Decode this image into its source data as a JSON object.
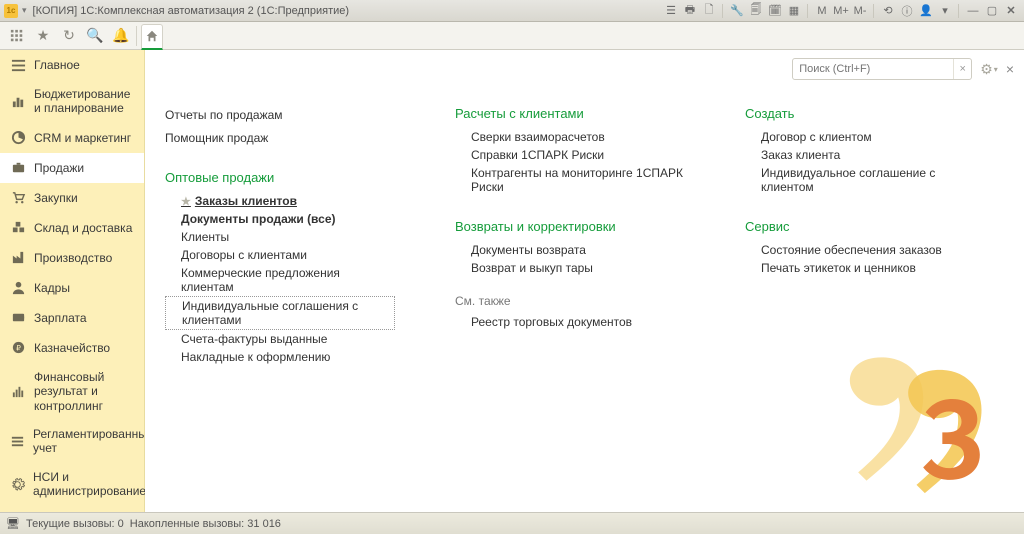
{
  "titlebar": {
    "title": "[КОПИЯ] 1С:Комплексная автоматизация 2  (1С:Предприятие)"
  },
  "search": {
    "placeholder": "Поиск (Ctrl+F)"
  },
  "sidebar": {
    "items": [
      {
        "label": "Главное"
      },
      {
        "label": "Бюджетирование и планирование"
      },
      {
        "label": "CRM и маркетинг"
      },
      {
        "label": "Продажи"
      },
      {
        "label": "Закупки"
      },
      {
        "label": "Склад и доставка"
      },
      {
        "label": "Производство"
      },
      {
        "label": "Кадры"
      },
      {
        "label": "Зарплата"
      },
      {
        "label": "Казначейство"
      },
      {
        "label": "Финансовый результат и контроллинг"
      },
      {
        "label": "Регламентированный учет"
      },
      {
        "label": "НСИ и администрирование"
      }
    ]
  },
  "col1": {
    "reports": "Отчеты по продажам",
    "assistant": "Помощник продаж",
    "section": "Оптовые продажи",
    "items": {
      "orders": "Заказы клиентов",
      "docs_all": "Документы продажи (все)",
      "clients": "Клиенты",
      "contracts": "Договоры с клиентами",
      "offers": "Коммерческие предложения клиентам",
      "agreements": "Индивидуальные соглашения с клиентами",
      "invoices": "Счета-фактуры выданные",
      "waybills": "Накладные к оформлению"
    }
  },
  "col2": {
    "s1": "Расчеты с клиентами",
    "s1_items": {
      "recon": "Сверки взаиморасчетов",
      "spark": "Справки 1СПАРК Риски",
      "monitor": "Контрагенты на мониторинге 1СПАРК Риски"
    },
    "s2": "Возвраты и корректировки",
    "s2_items": {
      "ret_docs": "Документы возврата",
      "ret_tare": "Возврат и выкуп тары"
    },
    "see_also": "См. также",
    "registry": "Реестр торговых документов"
  },
  "col3": {
    "s1": "Создать",
    "s1_items": {
      "contract": "Договор с клиентом",
      "order": "Заказ клиента",
      "agreement": "Индивидуальное соглашение с клиентом"
    },
    "s2": "Сервис",
    "s2_items": {
      "supply": "Состояние обеспечения заказов",
      "print": "Печать этикеток и ценников"
    }
  },
  "statusbar": {
    "current": "Текущие вызовы: 0",
    "accum": "Накопленные вызовы: 31 016"
  }
}
